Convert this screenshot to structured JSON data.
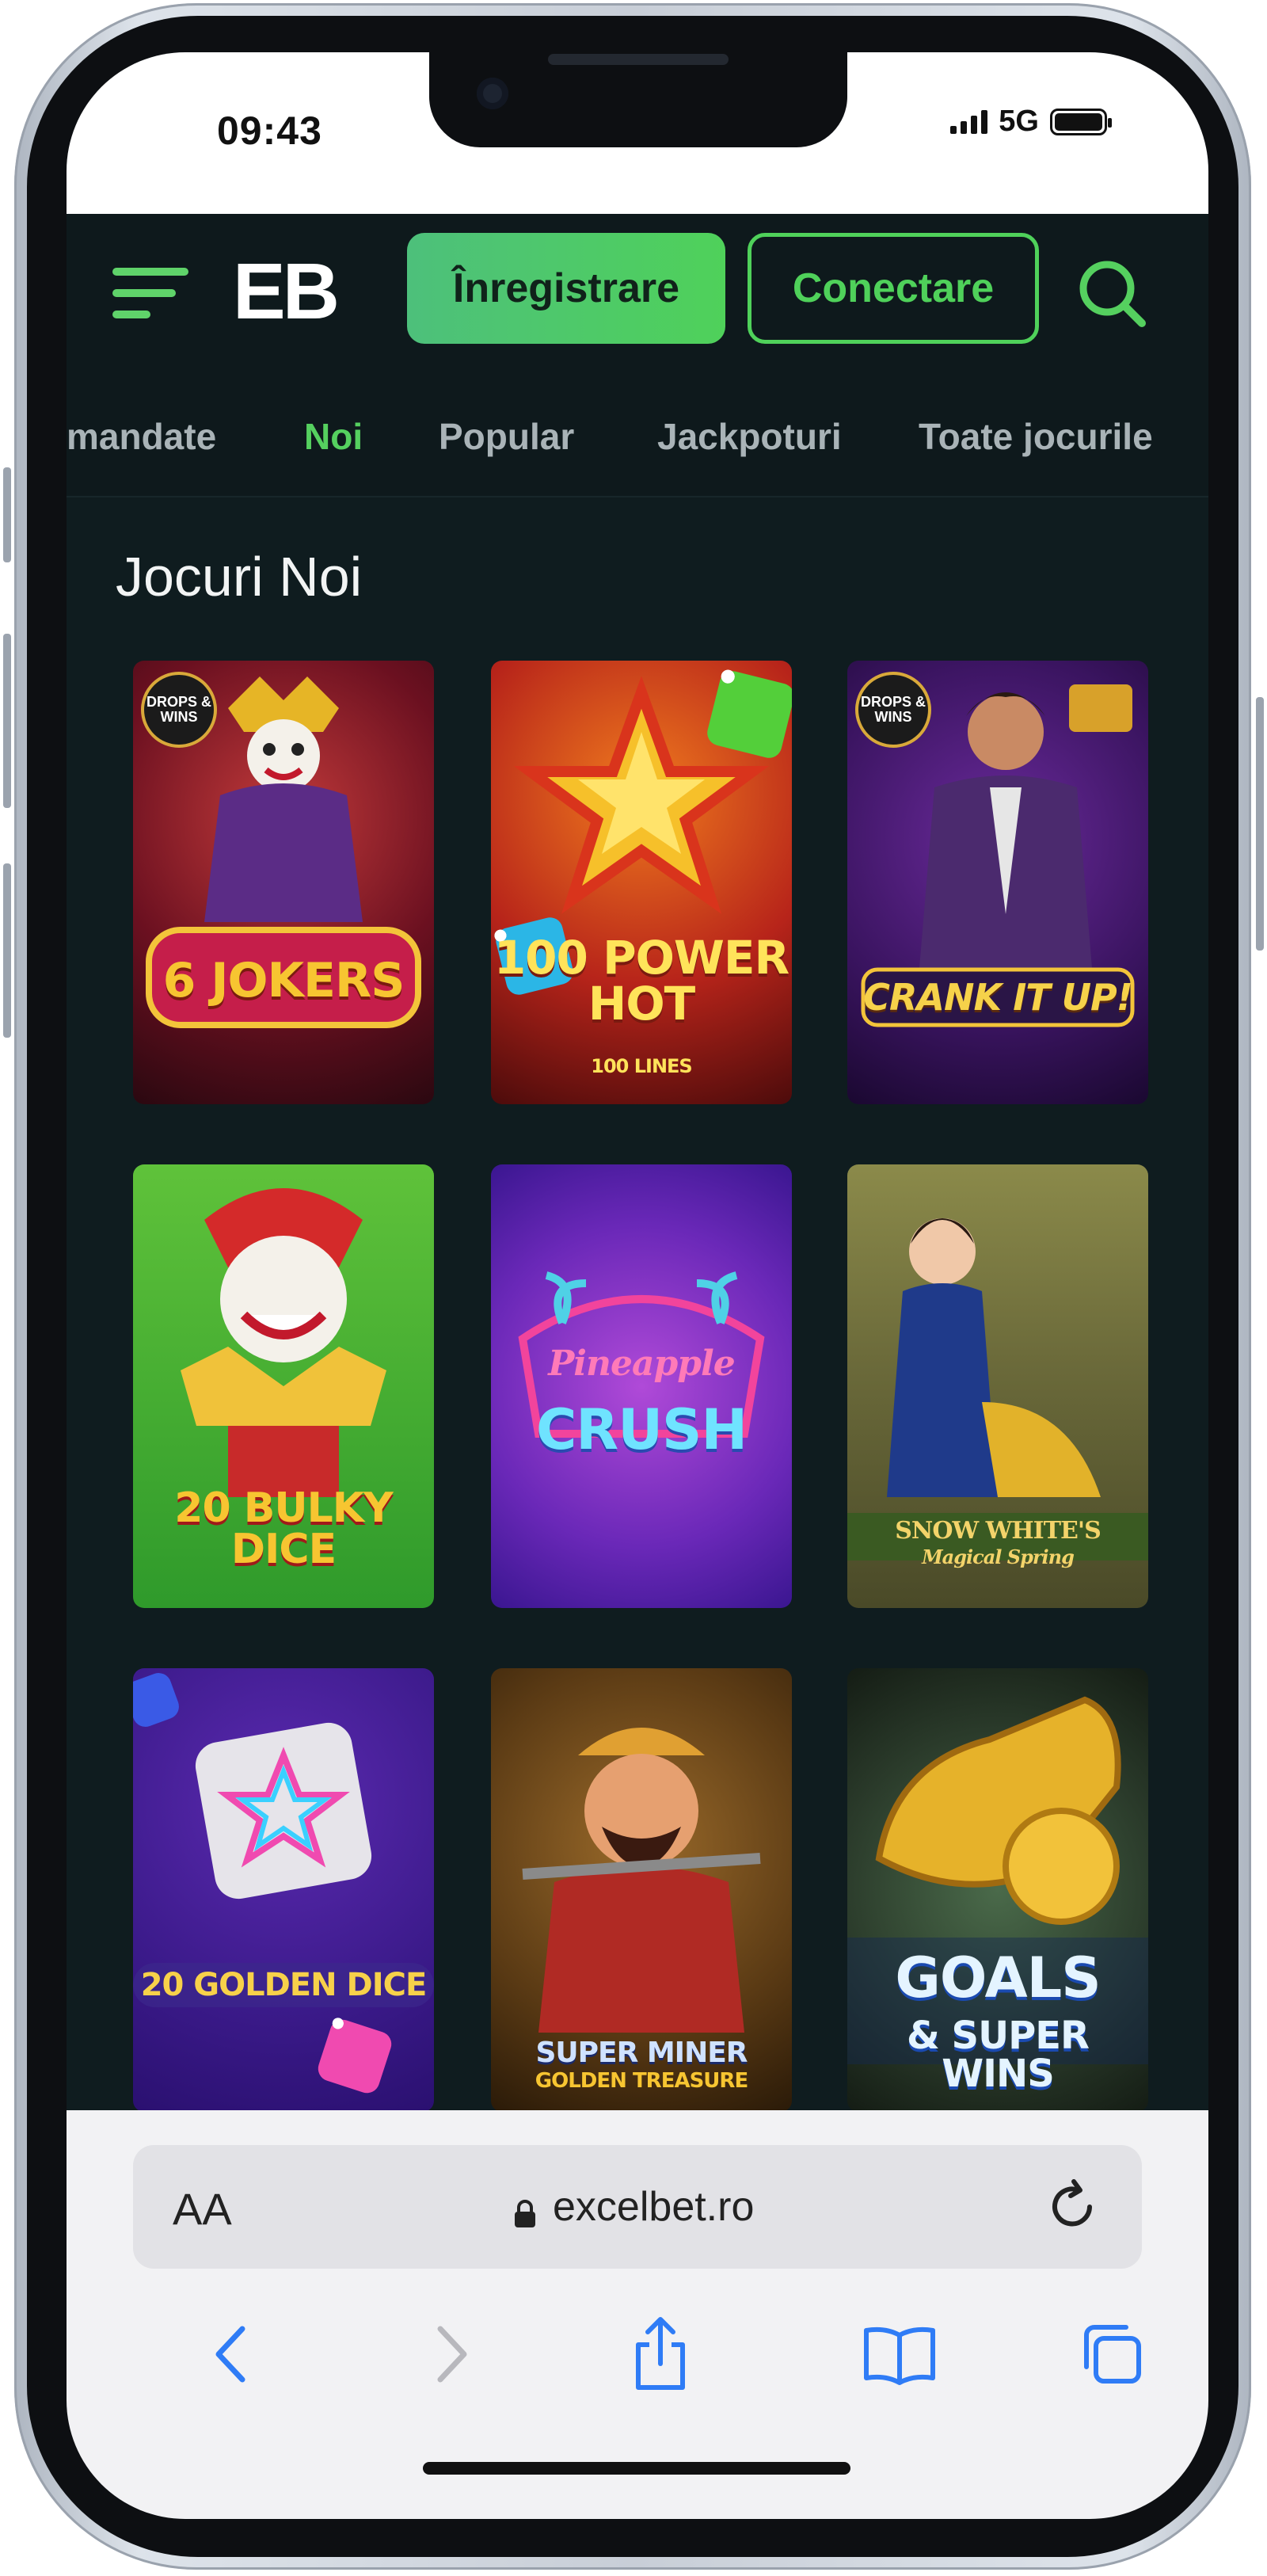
{
  "status_bar": {
    "time": "09:43",
    "network": "5G"
  },
  "header": {
    "logo": "EB",
    "register_label": "Înregistrare",
    "login_label": "Conectare"
  },
  "tabs": [
    {
      "label": "mandate",
      "active": false
    },
    {
      "label": "Noi",
      "active": true
    },
    {
      "label": "Popular",
      "active": false
    },
    {
      "label": "Jackpoturi",
      "active": false
    },
    {
      "label": "Toate jocurile",
      "active": false
    }
  ],
  "section": {
    "title": "Jocuri Noi"
  },
  "games": [
    {
      "title": "6 JOKERS",
      "badge": "DROPS & WINS"
    },
    {
      "title": "100 POWER HOT",
      "subtitle": "100 LINES"
    },
    {
      "title": "CRANK IT UP!",
      "badge": "DROPS & WINS"
    },
    {
      "title": "20 BULKY DICE"
    },
    {
      "title": "Pineapple",
      "subtitle": "CRUSH"
    },
    {
      "title": "SNOW WHITE'S",
      "subtitle": "Magical Spring"
    },
    {
      "title": "20 GOLDEN DICE"
    },
    {
      "title": "SUPER MINER",
      "subtitle": "GOLDEN TREASURE"
    },
    {
      "title": "GOALS",
      "subtitle": "& SUPER WINS"
    }
  ],
  "safari": {
    "text_size_label": "AA",
    "url": "excelbet.ro"
  },
  "colors": {
    "accent": "#4fd15a",
    "background": "#0f1c1f",
    "header": "#0e191c"
  }
}
